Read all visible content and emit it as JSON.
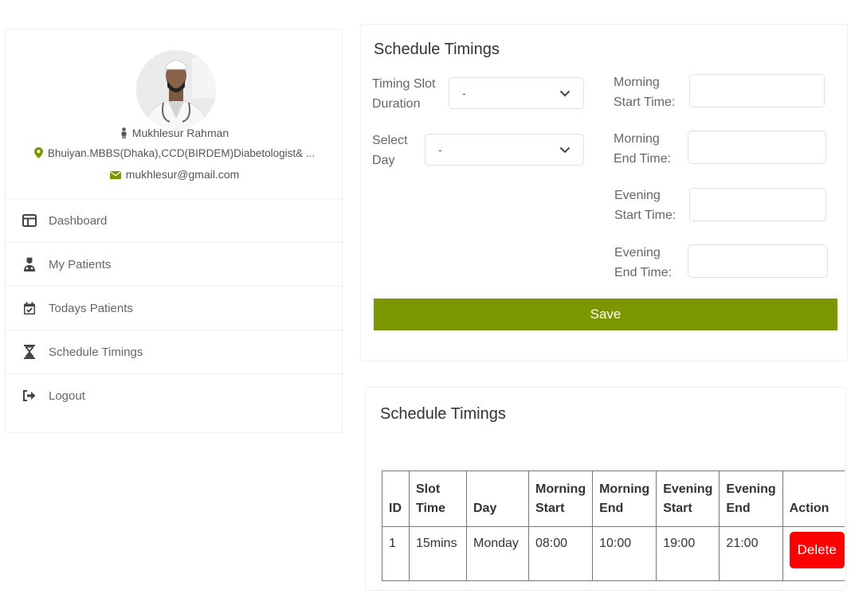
{
  "profile": {
    "name": "Mukhlesur Rahman",
    "qualification": "Bhuiyan.MBBS(Dhaka),CCD(BIRDEM)Diabetologist& ...",
    "email": "mukhlesur@gmail.com"
  },
  "nav": {
    "items": [
      {
        "label": "Dashboard",
        "icon": "dashboard-icon"
      },
      {
        "label": "My Patients",
        "icon": "user-md-icon"
      },
      {
        "label": "Todays Patients",
        "icon": "calendar-check-icon"
      },
      {
        "label": "Schedule Timings",
        "icon": "hourglass-icon"
      },
      {
        "label": "Logout",
        "icon": "sign-out-icon"
      }
    ]
  },
  "form": {
    "title": "Schedule Timings",
    "timing_slot_label_1": "Timing Slot",
    "timing_slot_label_2": "Duration",
    "timing_slot_value": "-",
    "select_day_label_1": "Select",
    "select_day_label_2": "Day",
    "select_day_value": "-",
    "morning_start_label_1": "Morning",
    "morning_start_label_2": "Start Time:",
    "morning_end_label_1": "Morning",
    "morning_end_label_2": "End Time:",
    "evening_start_label_1": "Evening",
    "evening_start_label_2": "Start Time:",
    "evening_end_label_1": "Evening",
    "evening_end_label_2": "End Time:",
    "save_label": "Save"
  },
  "table": {
    "title": "Schedule Timings",
    "headers": [
      [
        "ID",
        ""
      ],
      [
        "Slot",
        "Time"
      ],
      [
        "Day",
        ""
      ],
      [
        "Morning",
        "Start"
      ],
      [
        "Morning",
        "End"
      ],
      [
        "Evening",
        "Start"
      ],
      [
        "Evening",
        "End"
      ],
      [
        "Action",
        ""
      ]
    ],
    "rows": [
      {
        "id": "1",
        "slot_time": "15mins",
        "day": "Monday",
        "morning_start": "08:00",
        "morning_end": "10:00",
        "evening_start": "19:00",
        "evening_end": "21:00",
        "action_label": "Delete"
      }
    ]
  },
  "colors": {
    "accent": "#7a9700",
    "danger": "#ff0000",
    "icon_green": "#7a9700"
  }
}
